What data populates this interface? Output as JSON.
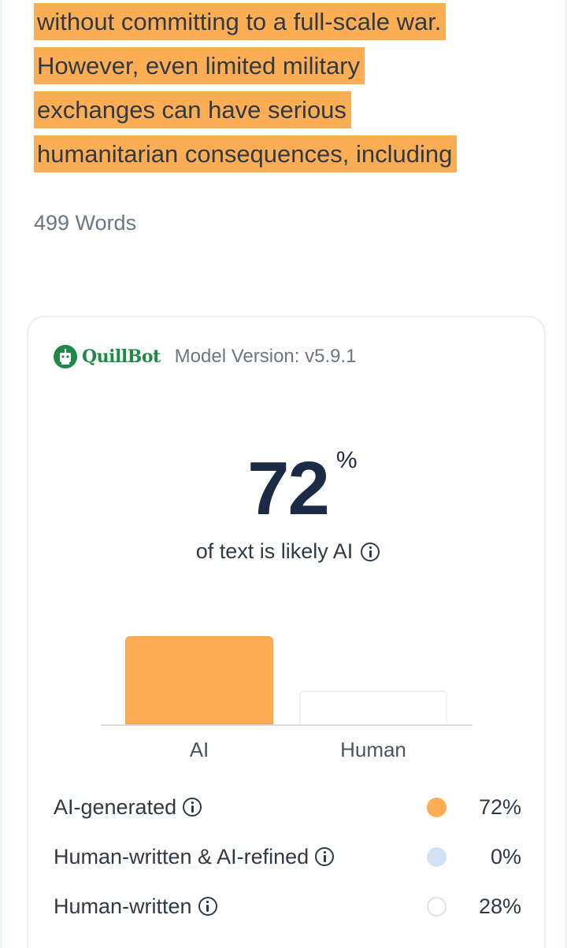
{
  "article": {
    "lines": [
      "without committing to a full-scale war.",
      "However, even limited military",
      "exchanges can have serious",
      "humanitarian consequences, including"
    ],
    "highlight_color": "#fdae55"
  },
  "word_count": "499 Words",
  "detector": {
    "brand": "QuillBot",
    "model_version": "Model Version: v5.9.1",
    "score_value": "72",
    "score_symbol": "%",
    "score_caption": "of text is likely AI",
    "legend": [
      {
        "label": "AI-generated",
        "value": "72%",
        "color": "#fdae55"
      },
      {
        "label": "Human-written & AI-refined",
        "value": "0%",
        "color": "#d3e2f7"
      },
      {
        "label": "Human-written",
        "value": "28%",
        "color": "#ffffff"
      }
    ]
  },
  "chart_data": {
    "type": "bar",
    "categories": [
      "AI",
      "Human"
    ],
    "values": [
      72,
      28
    ],
    "ylim": [
      0,
      100
    ],
    "colors": [
      "#fdae55",
      "#ffffff"
    ],
    "grid": false
  }
}
